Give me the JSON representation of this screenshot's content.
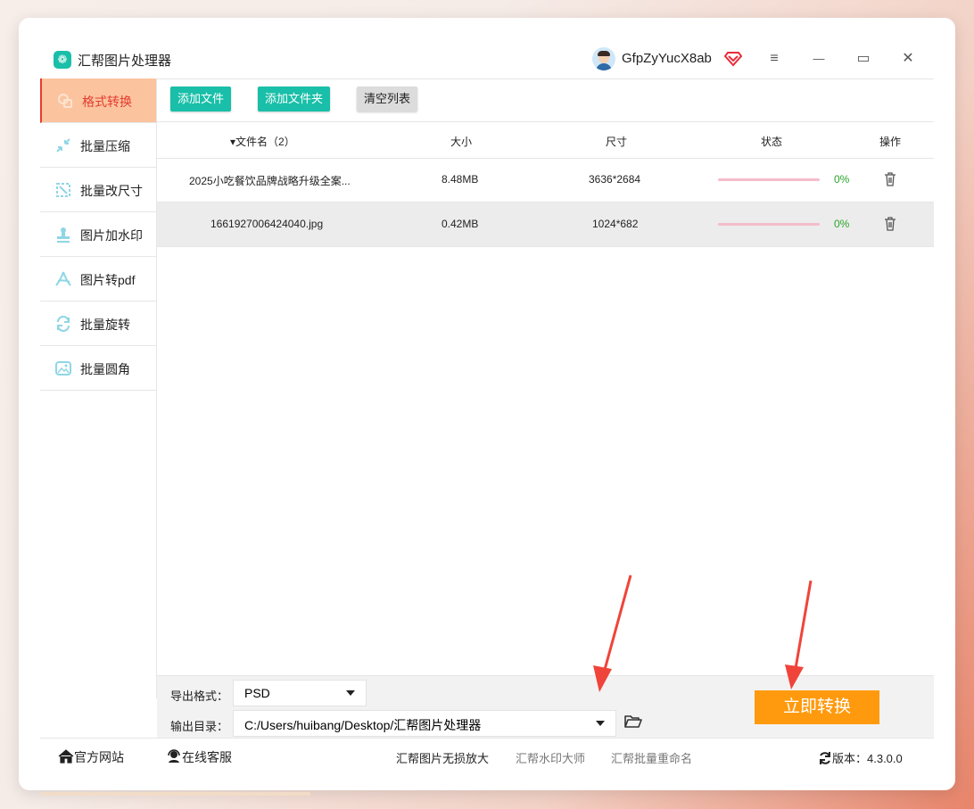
{
  "app": {
    "title": "汇帮图片处理器",
    "logo_glyph": "❁"
  },
  "user": {
    "name": "GfpZyYucX8ab",
    "vip_icon": "vip-diamond-icon"
  },
  "window_controls": {
    "menu": "≡",
    "minimize": "—",
    "maximize": "▭",
    "close": "✕"
  },
  "sidebar": {
    "items": [
      {
        "label": "格式转换",
        "icon": "format-convert-icon",
        "active": true
      },
      {
        "label": "批量压缩",
        "icon": "compress-icon"
      },
      {
        "label": "批量改尺寸",
        "icon": "resize-icon"
      },
      {
        "label": "图片加水印",
        "icon": "watermark-icon"
      },
      {
        "label": "图片转pdf",
        "icon": "pdf-icon"
      },
      {
        "label": "批量旋转",
        "icon": "rotate-icon"
      },
      {
        "label": "批量圆角",
        "icon": "rounded-corner-icon"
      }
    ]
  },
  "toolbar": {
    "add_file": "添加文件",
    "add_folder": "添加文件夹",
    "clear_list": "清空列表"
  },
  "table": {
    "headers": {
      "filename": "▾文件名（2）",
      "size": "大小",
      "dimensions": "尺寸",
      "status": "状态",
      "actions": "操作"
    },
    "rows": [
      {
        "filename": "2025小吃餐饮品牌战略升级全案...",
        "size": "8.48MB",
        "dimensions": "3636*2684",
        "progress": 0,
        "status": "0%"
      },
      {
        "filename": "1661927006424040.jpg",
        "size": "0.42MB",
        "dimensions": "1024*682",
        "progress": 0,
        "status": "0%"
      }
    ]
  },
  "settings": {
    "format_label": "导出格式：",
    "format_value": "PSD",
    "output_label": "输出目录：",
    "output_value": "C:/Users/huibang/Desktop/汇帮图片处理器",
    "convert_button": "立即转换"
  },
  "footer": {
    "website": "官方网站",
    "support": "在线客服",
    "link1": "汇帮图片无损放大",
    "link2": "汇帮水印大师",
    "link3": "汇帮批量重命名",
    "version_label": "版本：4.3.0.0"
  },
  "colors": {
    "accent": "#19bfa8",
    "active_tab": "#fbc49f",
    "active_text": "#e43c2f",
    "convert": "#ff9a0e",
    "arrow": "#f0443a"
  }
}
